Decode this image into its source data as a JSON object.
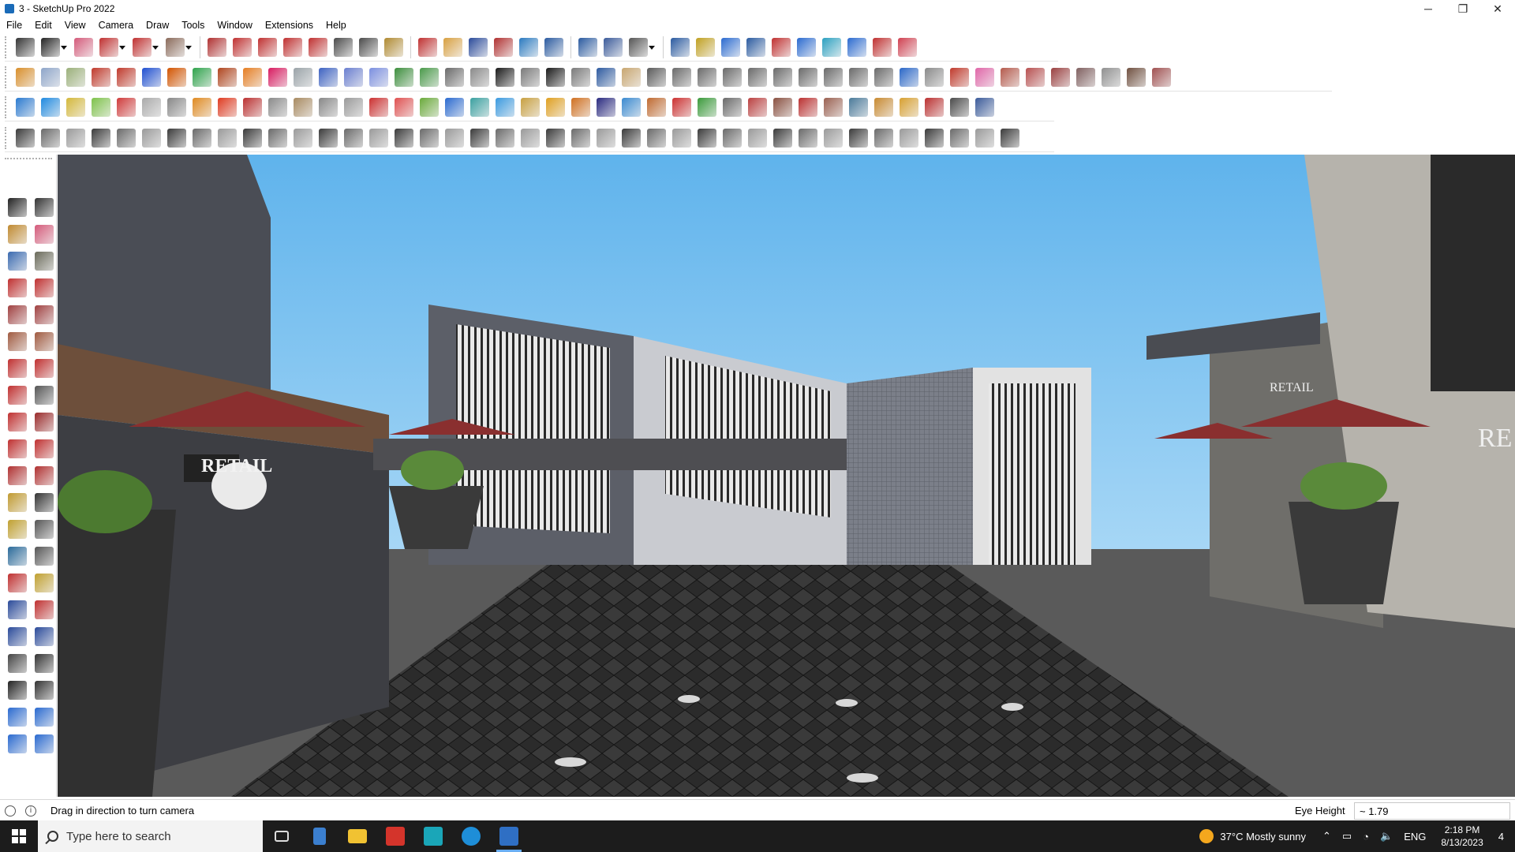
{
  "window": {
    "title": "3 - SketchUp Pro 2022",
    "controls": {
      "minimize": "─",
      "maximize": "❐",
      "close": "✕"
    }
  },
  "menu": [
    "File",
    "Edit",
    "View",
    "Camera",
    "Draw",
    "Tools",
    "Window",
    "Extensions",
    "Help"
  ],
  "toolbars": {
    "row1": [
      "zoom-icon",
      "select-icon",
      "eraser-icon",
      "pencil-icon",
      "freehand-icon",
      "rectangle-icon",
      "pushpull-icon",
      "followme-icon",
      "move-icon",
      "rotate-icon",
      "scale-icon",
      "tape-icon",
      "text-icon",
      "paint-icon",
      "orbit-icon",
      "pan-icon",
      "zoom-window-icon",
      "zoom-extents-icon",
      "warehouse-icon",
      "extension-icon",
      "layers-icon",
      "styles-icon",
      "account-icon",
      "component-icon",
      "material-icon",
      "section-icon",
      "axes-up-icon",
      "axes-down-icon",
      "dimension-icon",
      "sandbox-icon",
      "undo-icon",
      "redo-icon",
      "hand-icon"
    ],
    "row2_colors": [
      "#d98f2b",
      "#8ea5c9",
      "#9bb07a",
      "#c0392b",
      "#c0392b",
      "#1f4fd1",
      "#d35400",
      "#2ea34b",
      "#b0451e",
      "#e67e22",
      "#d81b60",
      "#9aa3a8",
      "#3d62c2",
      "#6a7fd0",
      "#7b8fe0",
      "#3c8e3c",
      "#4a9a4a",
      "#6a6a6a",
      "#8a8a8a",
      "#1a1a1a",
      "#7a7a7a",
      "#1a1a1a",
      "#7a7a7a",
      "#2d5aa0",
      "#c8a670",
      "#5a5a5a",
      "#6a6a6a",
      "#6a6a6a",
      "#6a6a6a",
      "#6a6a6a",
      "#6a6a6a",
      "#6a6a6a",
      "#6a6a6a",
      "#6a6a6a",
      "#6a6a6a",
      "#2a67c8",
      "#8a8a8a",
      "#c0392b",
      "#e066a8",
      "#b55a4c",
      "#b85050",
      "#9a4040",
      "#806060",
      "#909090",
      "#705040",
      "#a05050"
    ],
    "row3_colors": [
      "#2a7ad0",
      "#1f8ae0",
      "#d4b83a",
      "#7ec24a",
      "#d03a3a",
      "#aaaaaa",
      "#888888",
      "#e08a20",
      "#e03a20",
      "#bb3030",
      "#8a8a8a",
      "#a88a60",
      "#888888",
      "#9a9a9a",
      "#cc3030",
      "#e05050",
      "#6aaa3a",
      "#2a6ad0",
      "#3aa0a0",
      "#3a9ae0",
      "#c8a040",
      "#e0a020",
      "#d07020",
      "#2a2a80",
      "#3a8ad0",
      "#c06a30",
      "#cc3030",
      "#3a9a3a",
      "#6a6a6a",
      "#bb4040",
      "#8a5040",
      "#bb3030",
      "#9a6050",
      "#4a7a9a",
      "#c88a30",
      "#d8a030",
      "#bb3030",
      "#4a4a4a",
      "#3a5a9a"
    ],
    "row4_count": 40,
    "left": [
      "select-icon",
      "orbit-icon",
      "paint-icon",
      "eraser-icon",
      "component-icon",
      "tape-icon",
      "pencil-icon",
      "freehand-icon",
      "rectangle-icon",
      "rotated-rect-icon",
      "circle-icon",
      "polygon-icon",
      "arc-icon",
      "arc2-icon",
      "pie-icon",
      "arc3-icon",
      "move-icon",
      "pushpull-icon",
      "rotate-icon",
      "followme-icon",
      "scale-icon",
      "offset-icon",
      "tape-measure-icon",
      "dimension-icon",
      "protractor-icon",
      "text-icon",
      "axes-icon",
      "3d-text-icon",
      "orbit2-icon",
      "pan-icon",
      "zoom-icon",
      "zoom-window-icon",
      "zoom-extents-icon",
      "previous-view-icon",
      "position-camera-icon",
      "look-around-icon",
      "walk-icon",
      "section-plane-icon",
      "warehouse-icon",
      "extension-icon",
      "layer-icon",
      "style-icon"
    ]
  },
  "status": {
    "message": "Drag in direction to turn camera",
    "measure_label": "Eye Height",
    "measure_value": "~ 1.79"
  },
  "scene": {
    "sign_left": "RETAIL",
    "sign_right": "RETAIL",
    "sign_far_right": "RE"
  },
  "taskbar": {
    "search_placeholder": "Type here to search",
    "weather": "37°C  Mostly sunny",
    "language": "ENG",
    "time": "2:18 PM",
    "date": "8/13/2023",
    "notifications": "4"
  }
}
